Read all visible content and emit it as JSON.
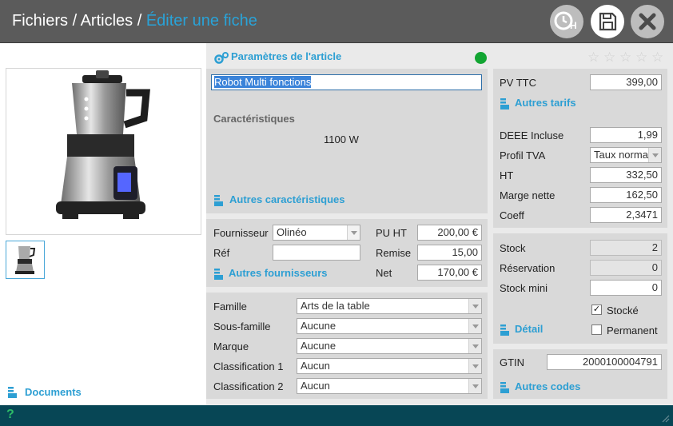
{
  "header": {
    "crumb_files": "Fichiers",
    "sep1": " / ",
    "crumb_articles": "Articles",
    "sep2": " / ",
    "crumb_current": "Éditer une fiche",
    "buttons": [
      {
        "name": "history-button",
        "icon": "clock-h-icon"
      },
      {
        "name": "save-button",
        "icon": "floppy-disk-icon"
      },
      {
        "name": "close-button",
        "icon": "close-icon"
      }
    ],
    "history_text": "H"
  },
  "left": {
    "documents_link": "Documents"
  },
  "params": {
    "title": "Paramètres de l'article",
    "status_color": "#12a532",
    "name_value": "Robot Multi fonctions",
    "characteristics_label": "Caractéristiques",
    "characteristics_value": "1100 W",
    "other_characteristics_link": "Autres caractéristiques"
  },
  "supplier": {
    "supplier_label": "Fournisseur",
    "supplier_value": "Olinéo",
    "ref_label": "Réf",
    "ref_value": "",
    "pu_ht_label": "PU HT",
    "pu_ht_value": "200,00 €",
    "discount_label": "Remise",
    "discount_value": "15,00",
    "net_label": "Net",
    "net_value": "170,00 €",
    "other_suppliers_link": "Autres fournisseurs"
  },
  "classification": {
    "rows": [
      {
        "label": "Famille",
        "value": "Arts de la table"
      },
      {
        "label": "Sous-famille",
        "value": "Aucune"
      },
      {
        "label": "Marque",
        "value": "Aucune"
      },
      {
        "label": "Classification 1",
        "value": "Aucun"
      },
      {
        "label": "Classification 2",
        "value": "Aucun"
      }
    ]
  },
  "rating": {
    "stars": 5,
    "filled": 0,
    "star_glyph": "☆"
  },
  "pricing": {
    "pv_ttc_label": "PV TTC",
    "pv_ttc_value": "399,00",
    "other_rates_link": "Autres tarifs",
    "deee_label": "DEEE Incluse",
    "deee_value": "1,99",
    "vat_label": "Profil TVA",
    "vat_value": "Taux normal",
    "ht_label": "HT",
    "ht_value": "332,50",
    "margin_label": "Marge nette",
    "margin_value": "162,50",
    "coeff_label": "Coeff",
    "coeff_value": "2,3471"
  },
  "stock": {
    "stock_label": "Stock",
    "stock_value": "2",
    "reservation_label": "Réservation",
    "reservation_value": "0",
    "min_label": "Stock mini",
    "min_value": "0",
    "stocked_label": "Stocké",
    "stocked_checked": true,
    "permanent_label": "Permanent",
    "permanent_checked": false,
    "detail_link": "Détail"
  },
  "gtin": {
    "label": "GTIN",
    "value": "2000100004791",
    "other_codes_link": "Autres codes"
  },
  "footer": {
    "help_glyph": "?"
  },
  "colors": {
    "accent": "#2d9fd3",
    "header": "#5b5b5b",
    "footer": "#074655",
    "status": "#12a532"
  }
}
